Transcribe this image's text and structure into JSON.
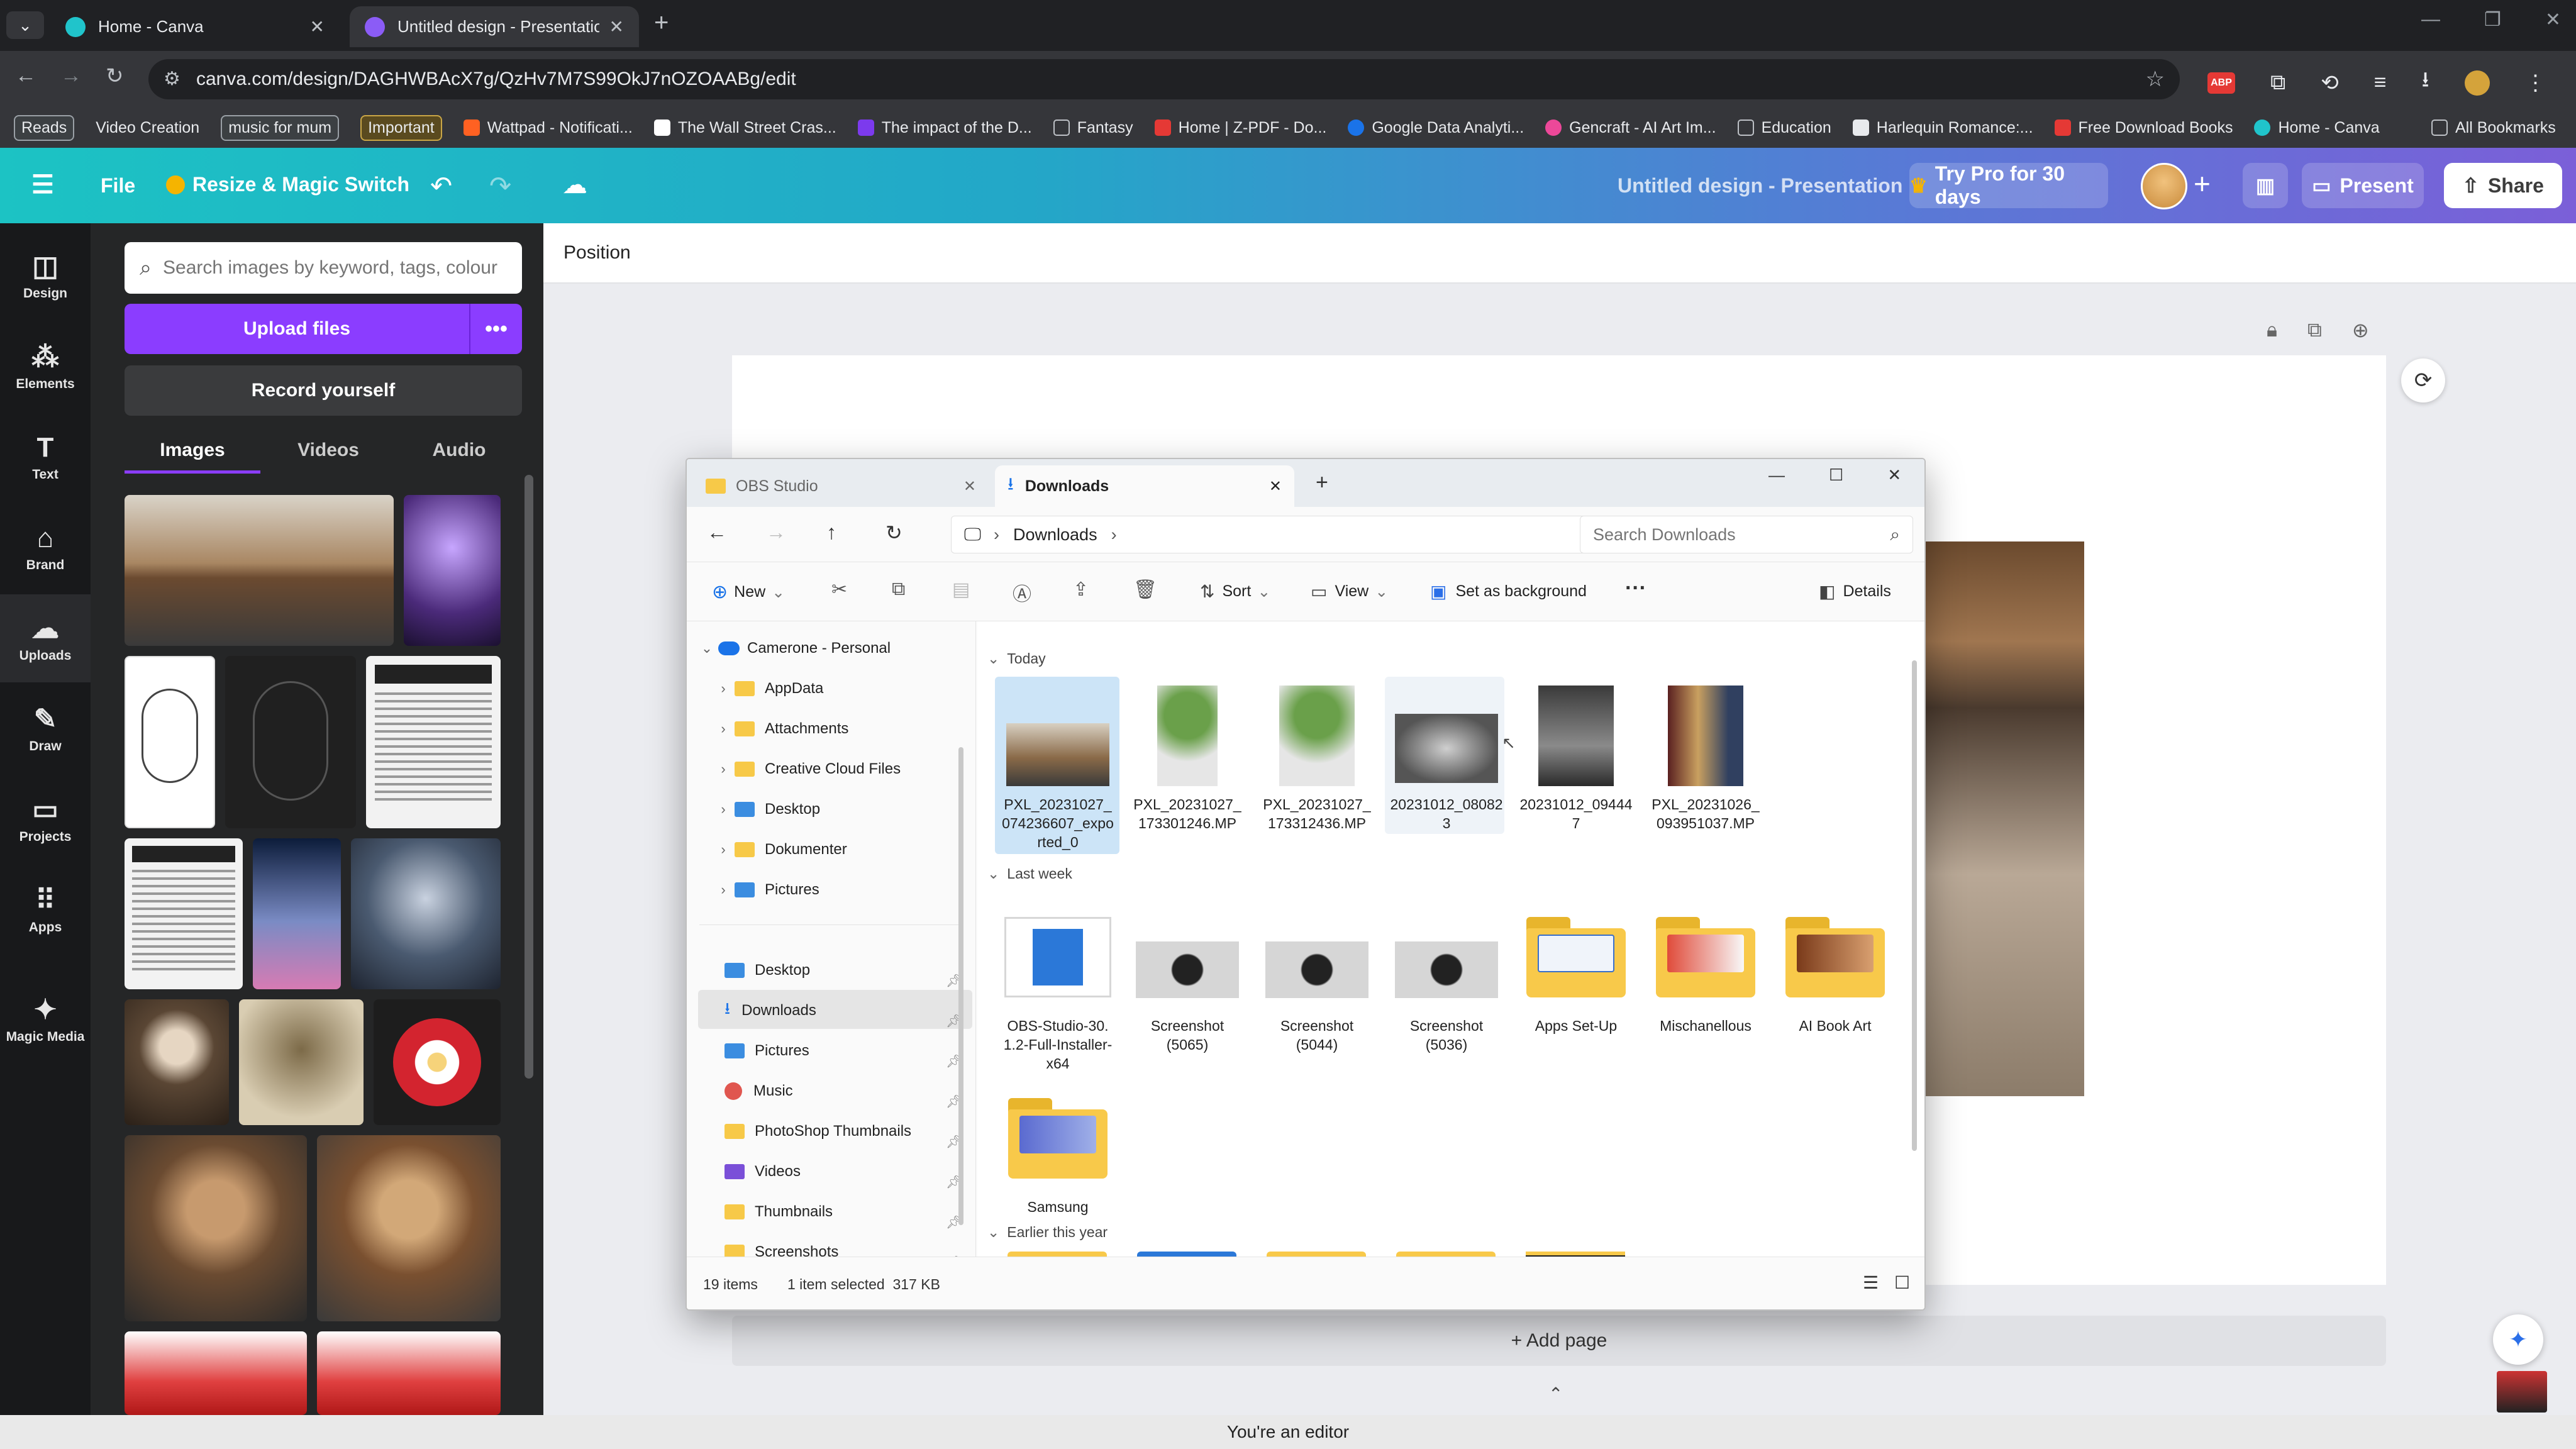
{
  "browser": {
    "tabs": [
      {
        "title": "Home - Canva",
        "active": false
      },
      {
        "title": "Untitled design - Presentation",
        "active": true
      }
    ],
    "url": "canva.com/design/DAGHWBAcX7g/QzHv7M7S99OkJ7nOZOAABg/edit",
    "bookmarks": [
      "Reads",
      "Video Creation",
      "music for mum",
      "Important",
      "Wattpad - Notificati...",
      "The Wall Street Cras...",
      "The impact of the D...",
      "Fantasy",
      "Home | Z-PDF - Do...",
      "Google Data Analyti...",
      "Gencraft - AI Art Im...",
      "Education",
      "Harlequin Romance:...",
      "Free Download Books",
      "Home - Canva"
    ],
    "all_bookmarks": "All Bookmarks"
  },
  "canva_header": {
    "file": "File",
    "resize": "Resize & Magic Switch",
    "design_title": "Untitled design - Presentation",
    "try_pro": "Try Pro for 30 days",
    "present": "Present",
    "share": "Share"
  },
  "rail": {
    "items": [
      {
        "label": "Design",
        "icon": "design-icon"
      },
      {
        "label": "Elements",
        "icon": "elements-icon"
      },
      {
        "label": "Text",
        "icon": "text-icon"
      },
      {
        "label": "Brand",
        "icon": "brand-icon"
      },
      {
        "label": "Uploads",
        "icon": "uploads-icon",
        "selected": true
      },
      {
        "label": "Draw",
        "icon": "draw-icon"
      },
      {
        "label": "Projects",
        "icon": "projects-icon"
      },
      {
        "label": "Apps",
        "icon": "apps-icon"
      },
      {
        "label": "Magic Media",
        "icon": "magic-media-icon"
      }
    ]
  },
  "uploads_panel": {
    "search_placeholder": "Search images by keyword, tags, colour",
    "upload_button": "Upload files",
    "record_button": "Record yourself",
    "tabs": [
      "Images",
      "Videos",
      "Audio"
    ],
    "active_tab": "Images"
  },
  "editor": {
    "position_label": "Position",
    "add_page": "+ Add page"
  },
  "explorer": {
    "tabs": [
      "OBS Studio",
      "Downloads"
    ],
    "breadcrumb": "Downloads",
    "search_placeholder": "Search Downloads",
    "commands": {
      "new": "New",
      "sort": "Sort",
      "view": "View",
      "set_background": "Set as background",
      "details": "Details"
    },
    "tree_root": "Camerone - Personal",
    "tree_children": [
      "AppData",
      "Attachments",
      "Creative Cloud Files",
      "Desktop",
      "Dokumenter",
      "Pictures"
    ],
    "quick_access": [
      "Desktop",
      "Downloads",
      "Pictures",
      "Music",
      "PhotoShop Thumbnails",
      "Videos",
      "Thumbnails",
      "Screenshots"
    ],
    "sections": {
      "today": "Today",
      "last_week": "Last week",
      "earlier": "Earlier this year"
    },
    "today_files": [
      "PXL_20231027_074236607_exported_0",
      "PXL_20231027_173301246.MP",
      "PXL_20231027_173312436.MP",
      "20231012_080823",
      "20231012_094447",
      "PXL_20231026_093951037.MP"
    ],
    "last_week_files": [
      "OBS-Studio-30.1.2-Full-Installer-x64",
      "Screenshot (5065)",
      "Screenshot (5044)",
      "Screenshot (5036)",
      "Apps Set-Up",
      "Mischanellous",
      "AI Book Art",
      "Samsung"
    ],
    "status_items": "19 items",
    "status_selected": "1 item selected  317 KB"
  },
  "bottom_status": "You're an editor",
  "colors": {
    "canva_purple": "#7d2ae8",
    "header_teal": "#1cc3c4",
    "header_violet": "#7b5fd8",
    "folder_yellow": "#f8c94a"
  }
}
